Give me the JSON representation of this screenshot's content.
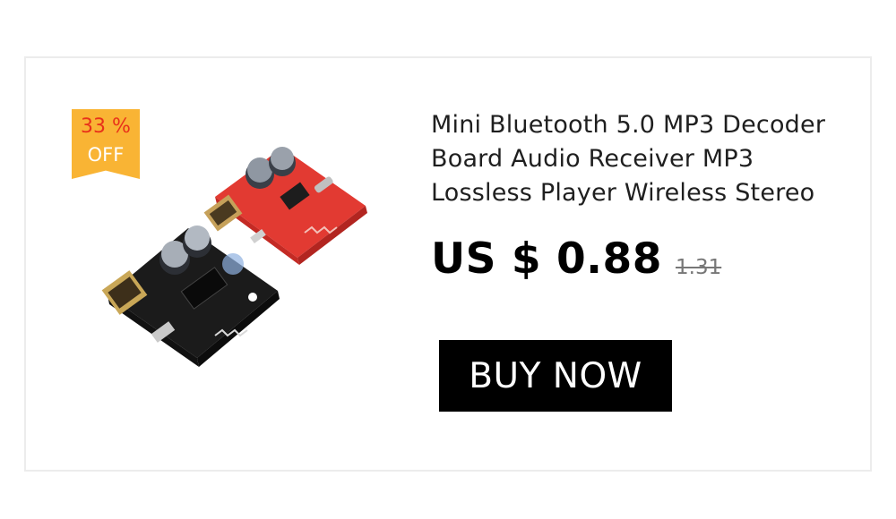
{
  "badge": {
    "percent": "33 %",
    "label": "OFF",
    "color": "#f9b434",
    "percent_color": "#e8311a"
  },
  "product": {
    "title": "Mini Bluetooth 5.0 MP3 Decoder Board Audio Receiver MP3 Lossless Player Wireless Stereo",
    "price": "US $ 0.88",
    "old_price": "1.31",
    "image_icon": "bluetooth-decoder-board-image"
  },
  "cta": {
    "label": "BUY NOW",
    "background": "#000000",
    "text_color": "#ffffff"
  }
}
